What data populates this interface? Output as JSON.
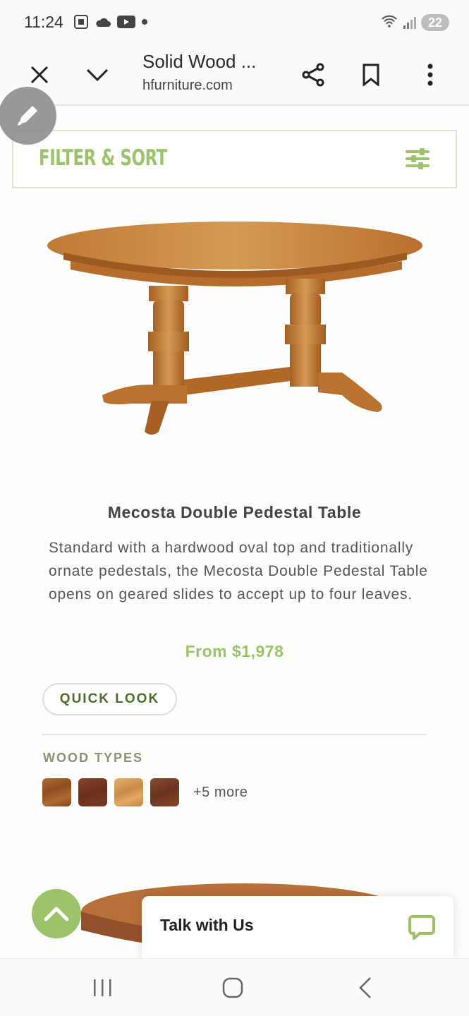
{
  "status": {
    "time": "11:24",
    "battery": "22"
  },
  "browser": {
    "title": "Solid Wood ...",
    "domain": "hfurniture.com"
  },
  "filter": {
    "label": "FILTER & SORT"
  },
  "product": {
    "name": "Mecosta Double Pedestal Table",
    "description": "Standard with a hardwood oval top and traditionally ornate pedestals, the Mecosta Double Pedestal Table opens on geared slides to accept up to four leaves.",
    "price": "From $1,978",
    "quick_look": "QUICK LOOK",
    "wood_types_title": "WOOD TYPES",
    "swatch_colors": [
      "#9b5a2b",
      "#7a3a22",
      "#d99c5b",
      "#7d4126"
    ],
    "more": "+5 more"
  },
  "chat": {
    "label": "Talk with Us"
  },
  "colors": {
    "accent": "#9cc36a"
  }
}
